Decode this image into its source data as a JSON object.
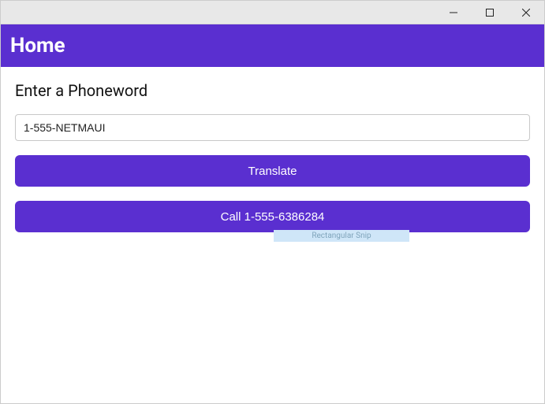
{
  "colors": {
    "primary": "#5A2FD0"
  },
  "titlebar": {
    "minimize_name": "minimize",
    "maximize_name": "maximize",
    "close_name": "close"
  },
  "header": {
    "title": "Home"
  },
  "main": {
    "prompt_label": "Enter a Phoneword",
    "phoneword_input_value": "1-555-NETMAUI",
    "translate_button_label": "Translate",
    "call_button_label": "Call 1-555-6386284"
  },
  "overlay": {
    "snip_text": "Rectangular Snip"
  }
}
